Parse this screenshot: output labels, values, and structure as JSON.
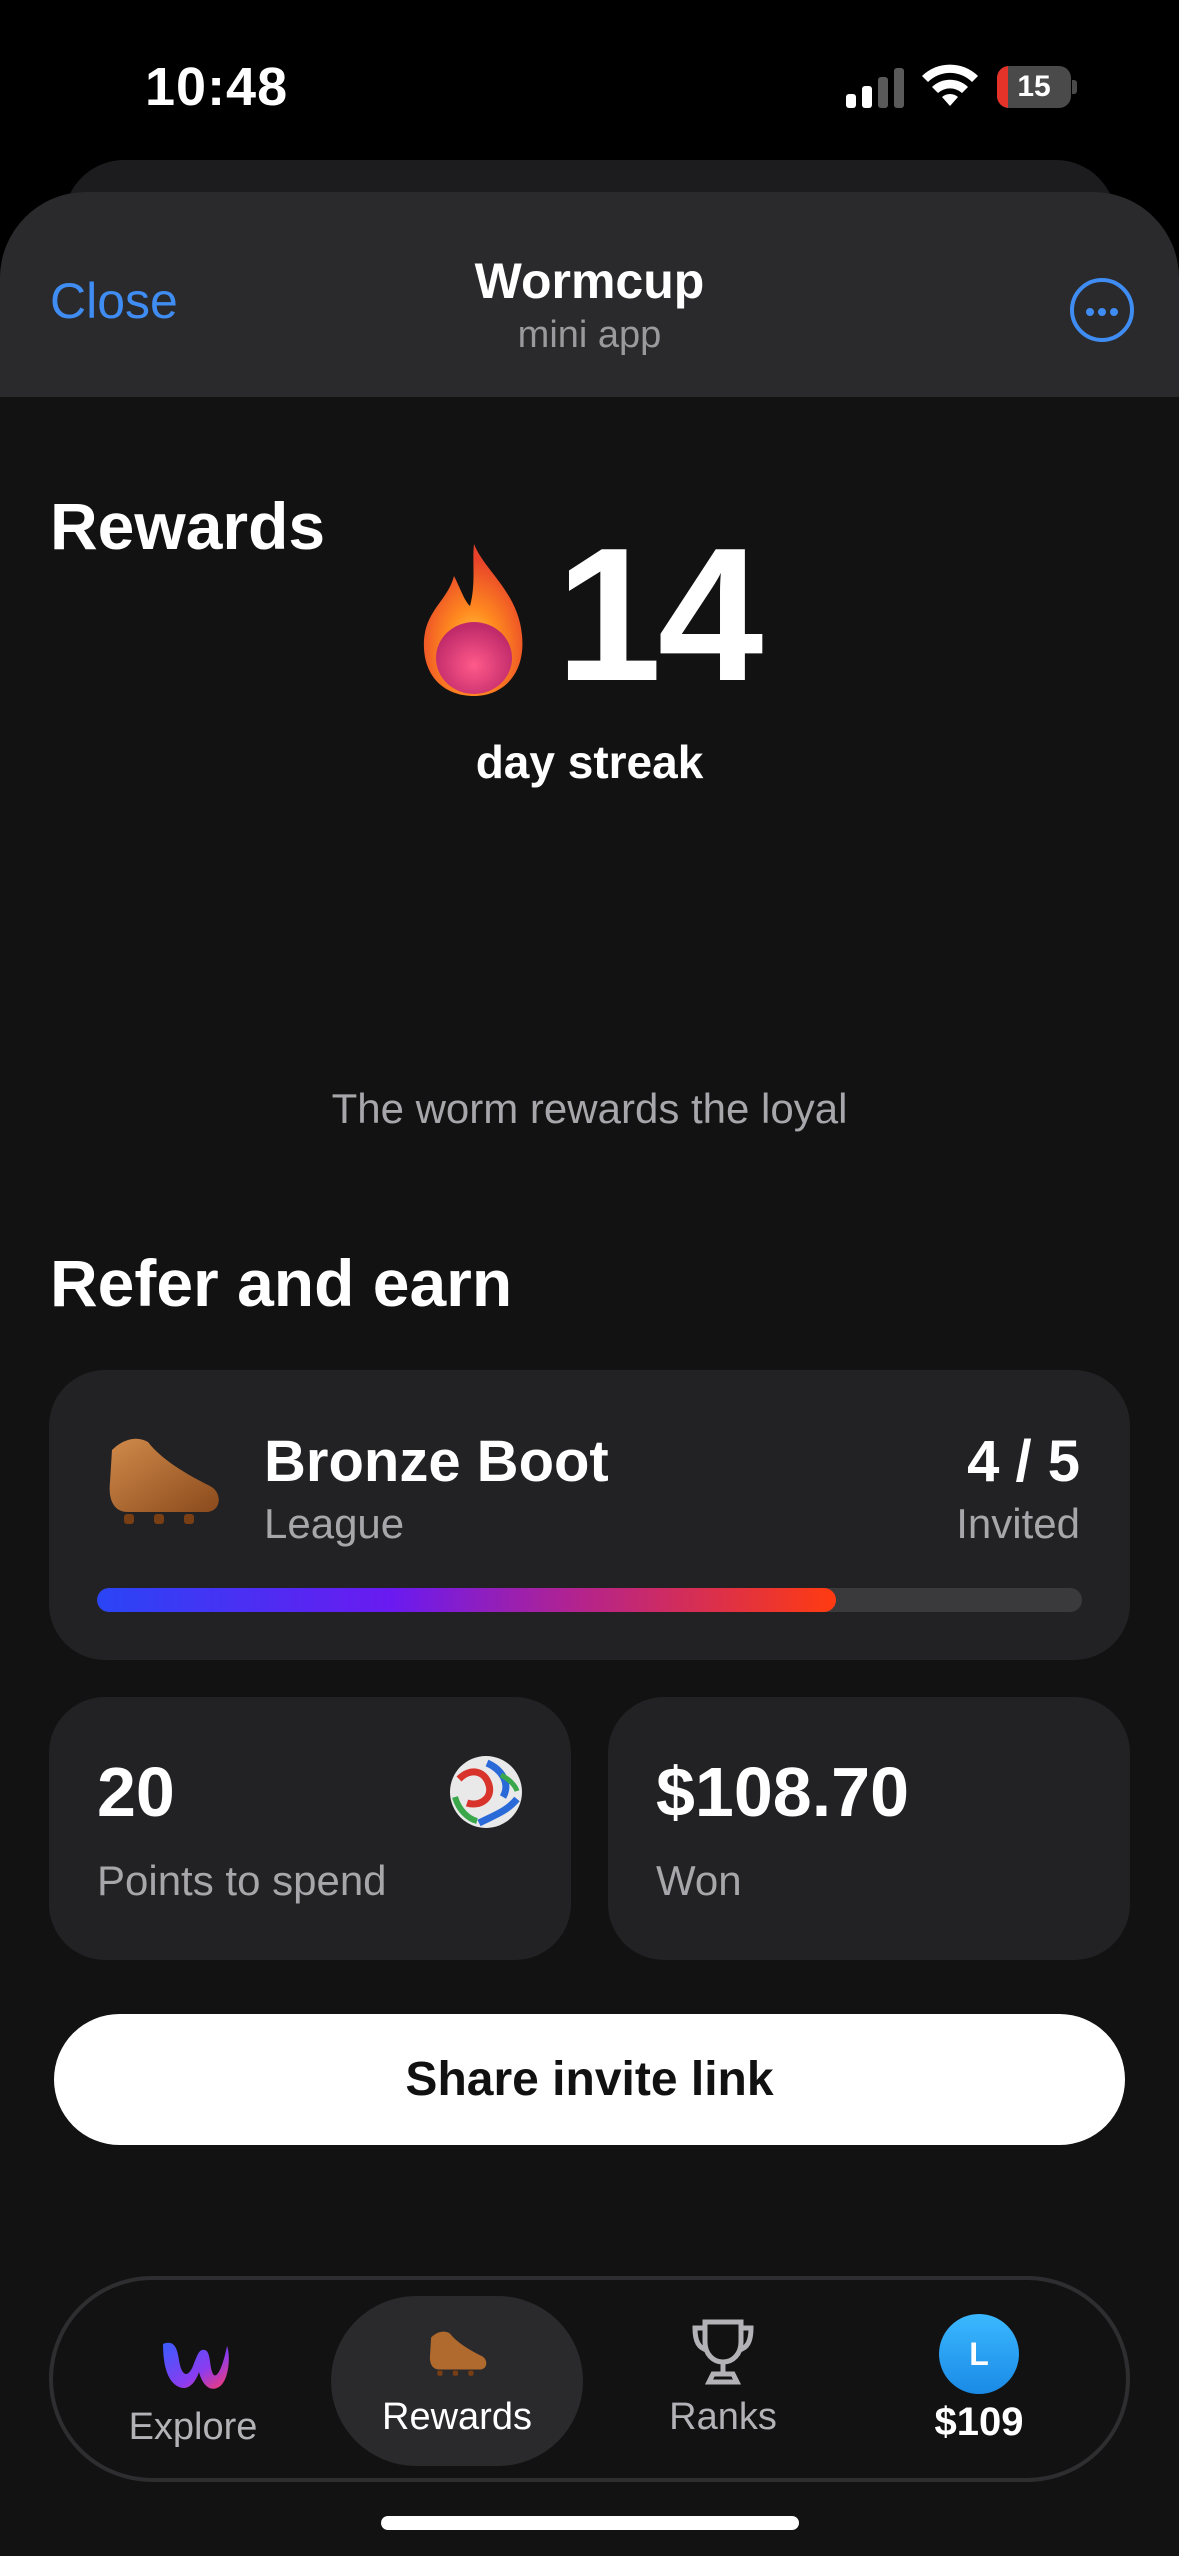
{
  "status_bar": {
    "time": "10:48",
    "battery_level": "15",
    "battery_fraction": 0.15
  },
  "header": {
    "close_label": "Close",
    "title": "Wormcup",
    "subtitle": "mini app",
    "more_icon": "ellipsis-circle-icon"
  },
  "rewards": {
    "title": "Rewards",
    "streak_number": "14",
    "streak_label": "day streak",
    "tagline": "The worm rewards the loyal",
    "streak_icon": "fire-icon"
  },
  "refer": {
    "title": "Refer and earn",
    "league": {
      "name": "Bronze Boot",
      "type": "League",
      "invite_count": "4 / 5",
      "invite_label": "Invited",
      "progress_fraction": 0.75,
      "icon": "boot-icon"
    },
    "points": {
      "value": "20",
      "label": "Points to spend",
      "icon": "ball-icon"
    },
    "won": {
      "value": "$108.70",
      "label": "Won"
    },
    "share_label": "Share invite link"
  },
  "nav": {
    "items": [
      {
        "label": "Explore",
        "icon": "wormcup-logo-icon"
      },
      {
        "label": "Rewards",
        "icon": "boot-icon"
      },
      {
        "label": "Ranks",
        "icon": "trophy-icon"
      },
      {
        "label": "$109",
        "icon": "avatar",
        "avatar_initial": "L"
      }
    ],
    "active": "Rewards"
  },
  "colors": {
    "accent": "#3f8cf3",
    "background": "#121212",
    "card": "#222224",
    "progress_start": "#2a45f5",
    "progress_end": "#ff3b10"
  }
}
